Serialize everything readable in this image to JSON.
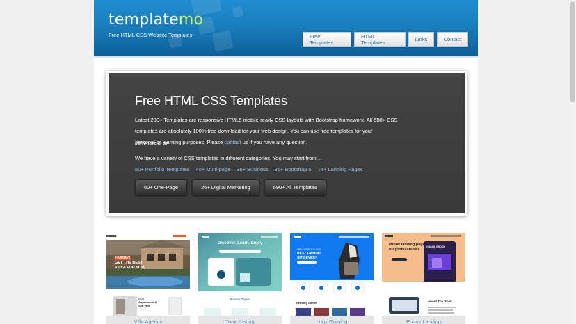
{
  "site": {
    "logo_main": "template",
    "logo_accent": "mo",
    "tagline": "Free HTML CSS Website Templates"
  },
  "nav": {
    "items": [
      {
        "label": "Free Templates"
      },
      {
        "label": "HTML Templates"
      },
      {
        "label": "Links"
      },
      {
        "label": "Contact"
      }
    ]
  },
  "hero": {
    "title": "Free HTML CSS Templates",
    "para1_line1": "Latest 200+ Templates are responsive HTML5 mobile-ready CSS layouts with Bootstrap framework. All 588+ CSS",
    "para1_line2": "templates are absolutely 100% free download for your web design. You can use free templates for your commercial or",
    "para1_line3_before": "personal or learning purposes. Please ",
    "para1_link": "contact",
    "para1_line3_after": " us if you have any question.",
    "para2": "We have a variety of CSS templates in different categories. You may start from ..",
    "category_links": [
      "50+ Portfolio Templates",
      "40+ Multi-page",
      "36+ Business",
      "31+ Bootstrap 5",
      "14+ Landing Pages"
    ],
    "buttons": [
      "60+ One-Page",
      "26+ Digital Marketing",
      "590+ All Templates"
    ]
  },
  "thumbnails": [
    {
      "caption": "Villa Agency",
      "brand": "VILLA",
      "headline_1": "HURRY!",
      "headline_2": "GET THE BEST",
      "headline_3": "VILLA FOR YOU",
      "sub_1": "Best",
      "sub_2": "Appartment &",
      "sub_3": "Sea View"
    },
    {
      "caption": "Topic Listing",
      "headline": "Discover. Learn. Enjoy",
      "sub": "Browse Topics"
    },
    {
      "caption": "Lugx Gaming",
      "headline_1": "WELCOME TO LUGX",
      "headline_2": "BEST GAMING",
      "headline_3": "SITE EVER!",
      "sub": "Trending Games"
    },
    {
      "caption": "Ebook Landing",
      "headline_1": "ebook landing page",
      "headline_2": "for professionals",
      "badge": "ONLINE EBOOK",
      "sub": "About The Book"
    }
  ]
}
